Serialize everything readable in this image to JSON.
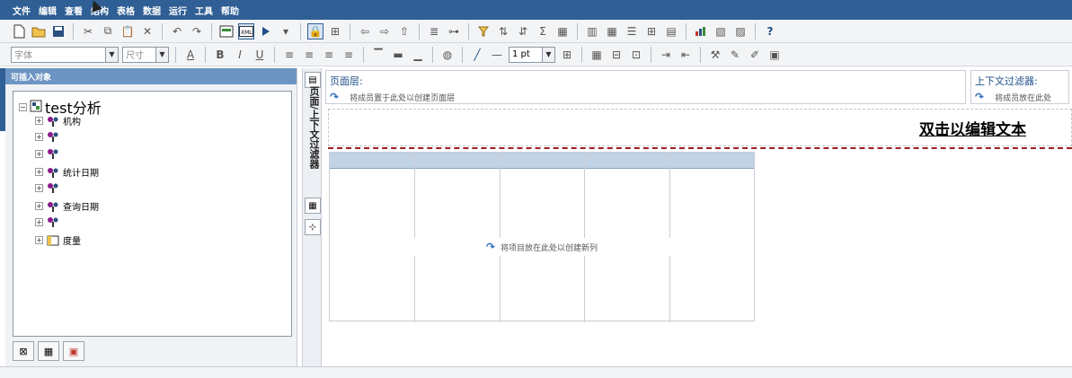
{
  "menu": [
    "文件",
    "编辑",
    "查看",
    "结构",
    "表格",
    "数据",
    "运行",
    "工具",
    "帮助"
  ],
  "toolbar2": {
    "font_placeholder": "字体",
    "size_placeholder": "尺寸",
    "line_width": "1 pt",
    "bold": "B",
    "italic": "I",
    "underline": "U"
  },
  "left_panel": {
    "header": "可插入对象",
    "root": "test分析",
    "items": [
      "机构",
      "",
      "",
      "统计日期",
      "",
      "查询日期",
      "",
      "度量"
    ]
  },
  "vertical_strip": {
    "label": "页面/上下文过滤器"
  },
  "content": {
    "page_layer_title": "页面层:",
    "page_layer_hint": "将成员置于此处以创建页面层",
    "context_filter_title": "上下文过滤器:",
    "context_filter_hint": "将成员放在此处",
    "header_text": "双击以编辑文本",
    "grid_hint": "将项目放在此处以创建新列"
  }
}
